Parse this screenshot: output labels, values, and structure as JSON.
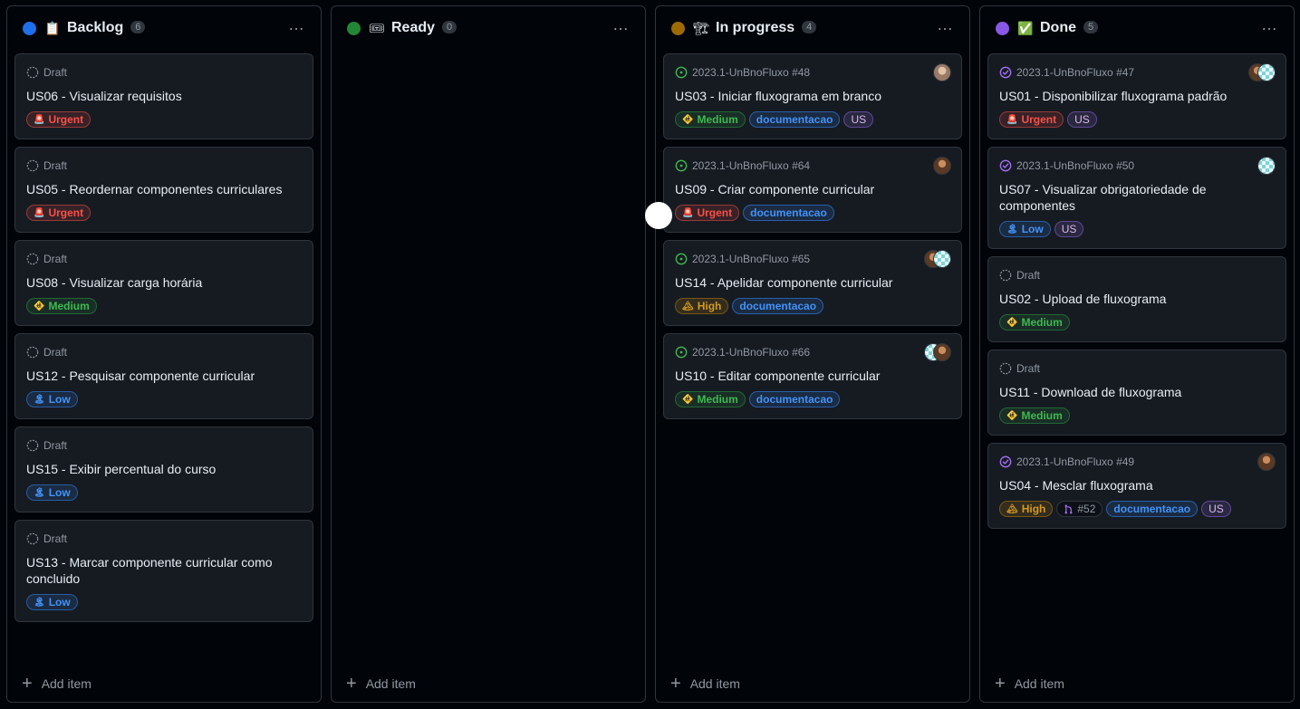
{
  "columns": [
    {
      "title": "Backlog",
      "count": "6",
      "color": "#1f6feb",
      "emoji": "📋",
      "add_label": "Add item",
      "cards": [
        {
          "meta": "Draft",
          "status": "draft",
          "title": "US06 - Visualizar requisitos",
          "labels": [
            {
              "text": "Urgent",
              "kind": "urgent",
              "emoji": "🚨"
            }
          ],
          "avatars": []
        },
        {
          "meta": "Draft",
          "status": "draft",
          "title": "US05 - Reordernar componentes curriculares",
          "labels": [
            {
              "text": "Urgent",
              "kind": "urgent",
              "emoji": "🚨"
            }
          ],
          "avatars": []
        },
        {
          "meta": "Draft",
          "status": "draft",
          "title": "US08 - Visualizar carga horária",
          "labels": [
            {
              "text": "Medium",
              "kind": "medium",
              "emoji": "🚸"
            }
          ],
          "avatars": []
        },
        {
          "meta": "Draft",
          "status": "draft",
          "title": "US12 - Pesquisar componente curricular",
          "labels": [
            {
              "text": "Low",
              "kind": "low",
              "emoji": "🏝"
            }
          ],
          "avatars": []
        },
        {
          "meta": "Draft",
          "status": "draft",
          "title": "US15 - Exibir percentual do curso",
          "labels": [
            {
              "text": "Low",
              "kind": "low",
              "emoji": "🏝"
            }
          ],
          "avatars": []
        },
        {
          "meta": "Draft",
          "status": "draft",
          "title": "US13 - Marcar componente curricular como concluido",
          "labels": [
            {
              "text": "Low",
              "kind": "low",
              "emoji": "🏝"
            }
          ],
          "avatars": []
        }
      ]
    },
    {
      "title": "Ready",
      "count": "0",
      "color": "#238636",
      "emoji": "🎟",
      "add_label": "Add item",
      "cards": []
    },
    {
      "title": "In progress",
      "count": "4",
      "color": "#9e6a03",
      "emoji": "🏗",
      "add_label": "Add item",
      "cards": [
        {
          "meta": "2023.1-UnBnoFluxo #48",
          "status": "open",
          "title": "US03 - Iniciar fluxograma em branco",
          "labels": [
            {
              "text": "Medium",
              "kind": "medium",
              "emoji": "🚸"
            },
            {
              "text": "documentacao",
              "kind": "doc"
            },
            {
              "text": "US",
              "kind": "us"
            }
          ],
          "avatars": [
            "b"
          ]
        },
        {
          "meta": "2023.1-UnBnoFluxo #64",
          "status": "open",
          "title": "US09 - Criar componente curricular",
          "labels": [
            {
              "text": "Urgent",
              "kind": "urgent",
              "emoji": "🚨"
            },
            {
              "text": "documentacao",
              "kind": "doc"
            }
          ],
          "avatars": [
            "a"
          ]
        },
        {
          "meta": "2023.1-UnBnoFluxo #65",
          "status": "open",
          "title": "US14 - Apelidar componente curricular",
          "labels": [
            {
              "text": "High",
              "kind": "high",
              "emoji": "🏔"
            },
            {
              "text": "documentacao",
              "kind": "doc"
            }
          ],
          "avatars": [
            "a",
            "c"
          ]
        },
        {
          "meta": "2023.1-UnBnoFluxo #66",
          "status": "open",
          "title": "US10 - Editar componente curricular",
          "labels": [
            {
              "text": "Medium",
              "kind": "medium",
              "emoji": "🚸"
            },
            {
              "text": "documentacao",
              "kind": "doc"
            }
          ],
          "avatars": [
            "c",
            "a"
          ]
        }
      ]
    },
    {
      "title": "Done",
      "count": "5",
      "color": "#8957e5",
      "emoji": "✅",
      "add_label": "Add item",
      "cards": [
        {
          "meta": "2023.1-UnBnoFluxo #47",
          "status": "closed",
          "title": "US01 - Disponibilizar fluxograma padrão",
          "labels": [
            {
              "text": "Urgent",
              "kind": "urgent",
              "emoji": "🚨"
            },
            {
              "text": "US",
              "kind": "us"
            }
          ],
          "avatars": [
            "a",
            "c"
          ]
        },
        {
          "meta": "2023.1-UnBnoFluxo #50",
          "status": "closed",
          "title": "US07 - Visualizar obrigatoriedade de componentes",
          "labels": [
            {
              "text": "Low",
              "kind": "low",
              "emoji": "🏝"
            },
            {
              "text": "US",
              "kind": "us"
            }
          ],
          "avatars": [
            "c"
          ]
        },
        {
          "meta": "Draft",
          "status": "draft",
          "title": "US02 - Upload de fluxograma",
          "labels": [
            {
              "text": "Medium",
              "kind": "medium",
              "emoji": "🚸"
            }
          ],
          "avatars": []
        },
        {
          "meta": "Draft",
          "status": "draft",
          "title": "US11 - Download de fluxograma",
          "labels": [
            {
              "text": "Medium",
              "kind": "medium",
              "emoji": "🚸"
            }
          ],
          "avatars": []
        },
        {
          "meta": "2023.1-UnBnoFluxo #49",
          "status": "closed",
          "title": "US04 - Mesclar fluxograma",
          "labels": [
            {
              "text": "High",
              "kind": "high",
              "emoji": "🏔"
            },
            {
              "text": "#52",
              "kind": "pr"
            },
            {
              "text": "documentacao",
              "kind": "doc"
            },
            {
              "text": "US",
              "kind": "us"
            }
          ],
          "avatars": [
            "a"
          ]
        }
      ]
    }
  ],
  "icons": {
    "menu": "…",
    "plus": "+",
    "draft": "draft-circle-icon",
    "open": "open-issue-icon",
    "closed": "closed-issue-icon",
    "pr": "pull-request-icon"
  }
}
